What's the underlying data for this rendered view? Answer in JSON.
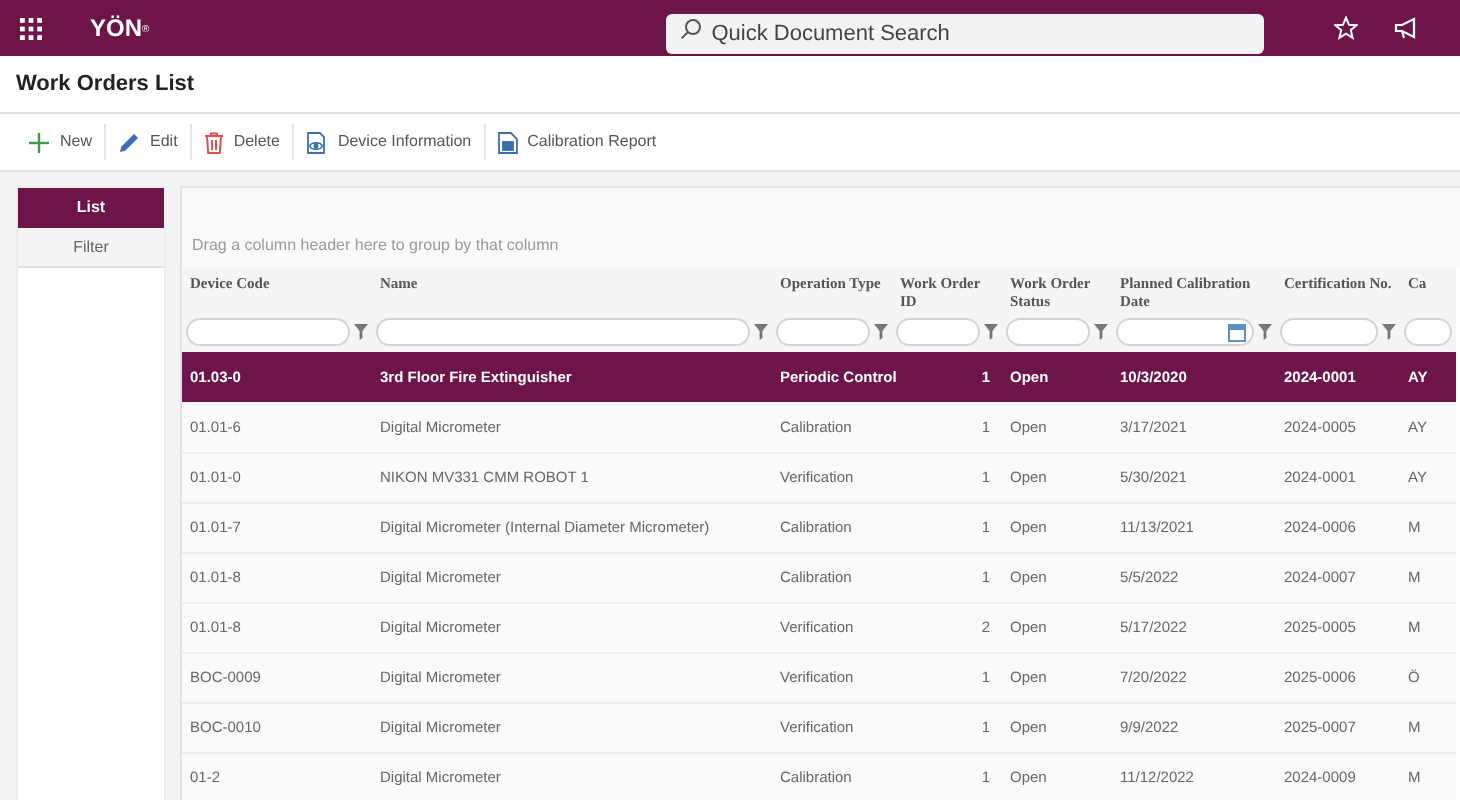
{
  "top_bar": {
    "logo": "YÖN",
    "logo_mark": "®",
    "search": {
      "placeholder": "Quick Document Search"
    }
  },
  "page_title": "Work Orders List",
  "toolbar": [
    {
      "label": "New",
      "kind": "new"
    },
    {
      "label": "Edit",
      "kind": "edit"
    },
    {
      "label": "Delete",
      "kind": "delete"
    },
    {
      "label": "Device Information",
      "kind": "info"
    },
    {
      "label": "Calibration Report",
      "kind": "report"
    }
  ],
  "side_tabs": [
    {
      "label": "List",
      "selected": true
    },
    {
      "label": "Filter",
      "selected": false
    }
  ],
  "grid": {
    "group_hint": "Drag a column header here to group by that column",
    "columns": [
      {
        "header": "Device Code",
        "kind": "text"
      },
      {
        "header": "Name",
        "kind": "text"
      },
      {
        "header": "Operation Type",
        "kind": "text"
      },
      {
        "header": "Work Order ID",
        "kind": "number"
      },
      {
        "header": "Work Order Status",
        "kind": "text"
      },
      {
        "header": "Planned Calibration Date",
        "kind": "date"
      },
      {
        "header": "Certification No.",
        "kind": "text"
      },
      {
        "header": "Ca",
        "kind": "text"
      }
    ],
    "rows": [
      {
        "selected": true,
        "cells": [
          "01.03-0",
          "3rd Floor Fire Extinguisher",
          "Periodic Control",
          "1",
          "Open",
          "10/3/2020",
          "2024-0001",
          "AY"
        ]
      },
      {
        "selected": false,
        "cells": [
          "01.01-6",
          "Digital Micrometer",
          "Calibration",
          "1",
          "Open",
          "3/17/2021",
          "2024-0005",
          "AY"
        ]
      },
      {
        "selected": false,
        "cells": [
          "01.01-0",
          "NIKON MV331 CMM ROBOT 1",
          "Verification",
          "1",
          "Open",
          "5/30/2021",
          "2024-0001",
          "AY"
        ]
      },
      {
        "selected": false,
        "cells": [
          "01.01-7",
          "Digital Micrometer (Internal Diameter Micrometer)",
          "Calibration",
          "1",
          "Open",
          "11/13/2021",
          "2024-0006",
          "M"
        ]
      },
      {
        "selected": false,
        "cells": [
          "01.01-8",
          "Digital Micrometer",
          "Calibration",
          "1",
          "Open",
          "5/5/2022",
          "2024-0007",
          "M"
        ]
      },
      {
        "selected": false,
        "cells": [
          "01.01-8",
          "Digital Micrometer",
          "Verification",
          "2",
          "Open",
          "5/17/2022",
          "2025-0005",
          "M"
        ]
      },
      {
        "selected": false,
        "cells": [
          "BOC-0009",
          "Digital Micrometer",
          "Verification",
          "1",
          "Open",
          "7/20/2022",
          "2025-0006",
          "Ö"
        ]
      },
      {
        "selected": false,
        "cells": [
          "BOC-0010",
          "Digital Micrometer",
          "Verification",
          "1",
          "Open",
          "9/9/2022",
          "2025-0007",
          "M"
        ]
      },
      {
        "selected": false,
        "cells": [
          "01-2",
          "Digital Micrometer",
          "Calibration",
          "1",
          "Open",
          "11/12/2022",
          "2024-0009",
          "M"
        ]
      }
    ]
  }
}
